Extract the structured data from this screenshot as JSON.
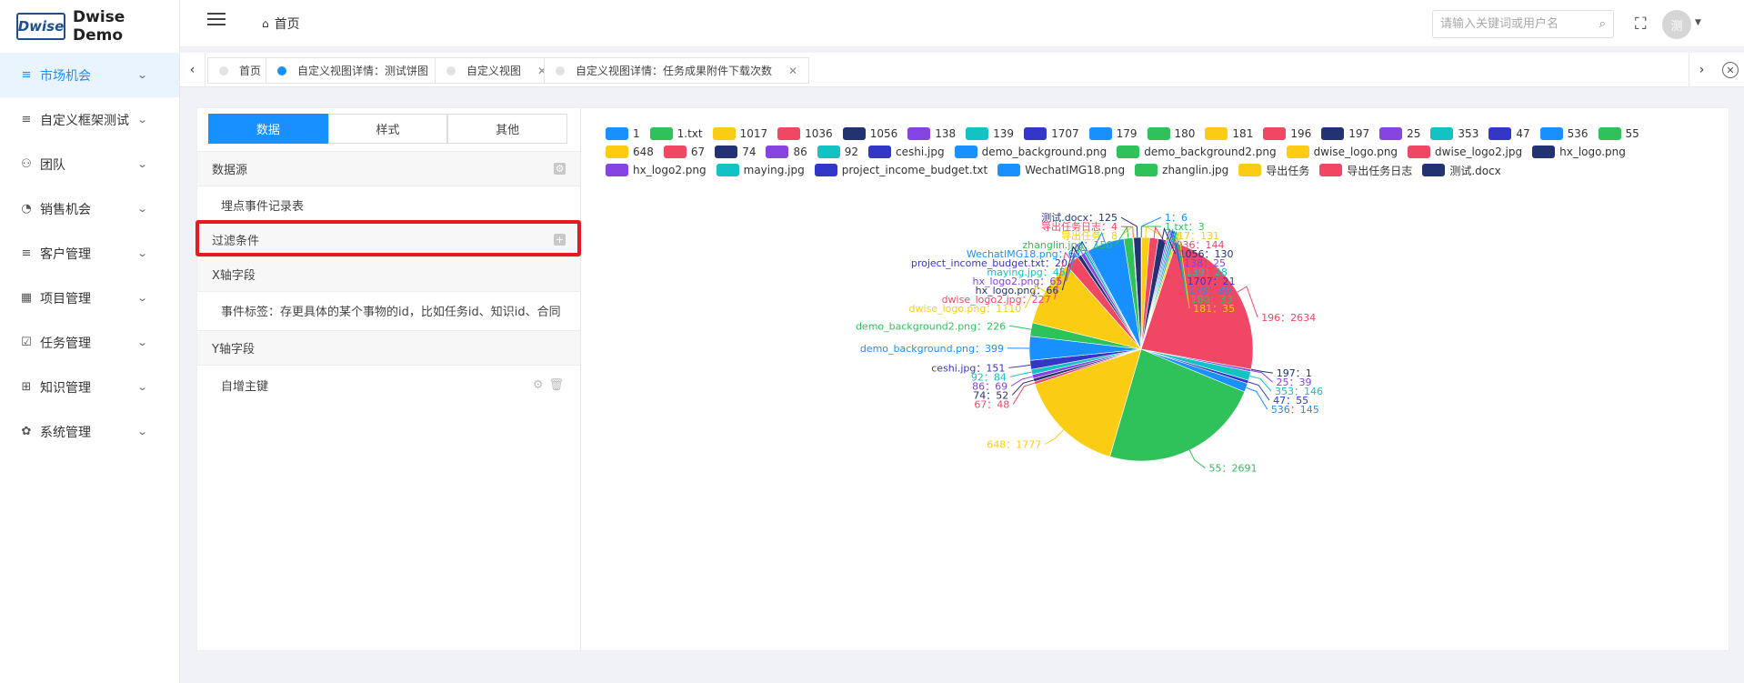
{
  "logo": {
    "mark": "Dwise",
    "text": "Dwise Demo"
  },
  "sidebar": {
    "items": [
      {
        "label": "市场机会",
        "icon": "list-icon",
        "glyph": "≡",
        "active": true
      },
      {
        "label": "自定义框架测试",
        "icon": "list-icon",
        "glyph": "≡",
        "active": false
      },
      {
        "label": "团队",
        "icon": "team-icon",
        "glyph": "⚇",
        "active": false
      },
      {
        "label": "销售机会",
        "icon": "pie-icon",
        "glyph": "◔",
        "active": false
      },
      {
        "label": "客户管理",
        "icon": "list-icon",
        "glyph": "≡",
        "active": false
      },
      {
        "label": "项目管理",
        "icon": "grid-icon",
        "glyph": "▦",
        "active": false
      },
      {
        "label": "任务管理",
        "icon": "checkbox-icon",
        "glyph": "☑",
        "active": false
      },
      {
        "label": "知识管理",
        "icon": "book-icon",
        "glyph": "⊞",
        "active": false
      },
      {
        "label": "系统管理",
        "icon": "gear-icon",
        "glyph": "✿",
        "active": false
      }
    ]
  },
  "header": {
    "breadcrumb": "首页",
    "search_placeholder": "请输入关键词或用户名",
    "avatar_text": "测"
  },
  "tabs": [
    {
      "label": "首页",
      "active": false,
      "closable": false
    },
    {
      "label": "自定义视图详情：测试饼图",
      "active": true,
      "closable": true
    },
    {
      "label": "自定义视图",
      "active": false,
      "closable": true
    },
    {
      "label": "自定义视图详情：任务成果附件下载次数",
      "active": false,
      "closable": true
    }
  ],
  "config": {
    "seg": [
      "数据",
      "样式",
      "其他"
    ],
    "datasource_title": "数据源",
    "datasource_value": "埋点事件记录表",
    "filter_title": "过滤条件",
    "x_title": "X轴字段",
    "x_value": "事件标签：存更具体的某个事物的id，比如任务id、知识id、合同",
    "y_title": "Y轴字段",
    "y_value": "自增主键"
  },
  "chart_data": {
    "type": "pie",
    "slices": [
      {
        "name": "1",
        "value": 6,
        "color": "#1890ff"
      },
      {
        "name": "1.txt",
        "value": 3,
        "color": "#2fc25b"
      },
      {
        "name": "1017",
        "value": 131,
        "color": "#facc14"
      },
      {
        "name": "1036",
        "value": 144,
        "color": "#f04864"
      },
      {
        "name": "1056",
        "value": 130,
        "color": "#223273"
      },
      {
        "name": "138",
        "value": 25,
        "color": "#8543e0"
      },
      {
        "name": "139",
        "value": 28,
        "color": "#13c2c2"
      },
      {
        "name": "1707",
        "value": 21,
        "color": "#3436c7"
      },
      {
        "name": "179",
        "value": 30,
        "color": "#1890ff"
      },
      {
        "name": "180",
        "value": 33,
        "color": "#2fc25b"
      },
      {
        "name": "181",
        "value": 35,
        "color": "#facc14"
      },
      {
        "name": "196",
        "value": 2634,
        "color": "#f04864"
      },
      {
        "name": "197",
        "value": 1,
        "color": "#223273"
      },
      {
        "name": "25",
        "value": 39,
        "color": "#8543e0"
      },
      {
        "name": "353",
        "value": 146,
        "color": "#13c2c2"
      },
      {
        "name": "47",
        "value": 55,
        "color": "#3436c7"
      },
      {
        "name": "536",
        "value": 145,
        "color": "#1890ff"
      },
      {
        "name": "55",
        "value": 2691,
        "color": "#2fc25b"
      },
      {
        "name": "648",
        "value": 1777,
        "color": "#facc14"
      },
      {
        "name": "67",
        "value": 48,
        "color": "#f04864"
      },
      {
        "name": "74",
        "value": 52,
        "color": "#223273"
      },
      {
        "name": "86",
        "value": 69,
        "color": "#8543e0"
      },
      {
        "name": "92",
        "value": 84,
        "color": "#13c2c2"
      },
      {
        "name": "ceshi.jpg",
        "value": 151,
        "color": "#3436c7"
      },
      {
        "name": "demo_background.png",
        "value": 399,
        "color": "#1890ff"
      },
      {
        "name": "demo_background2.png",
        "value": 226,
        "color": "#2fc25b"
      },
      {
        "name": "dwise_logo.png",
        "value": 1110,
        "color": "#facc14"
      },
      {
        "name": "dwise_logo2.jpg",
        "value": 227,
        "color": "#f04864"
      },
      {
        "name": "hx_logo.png",
        "value": 66,
        "color": "#223273"
      },
      {
        "name": "hx_logo2.png",
        "value": 65,
        "color": "#8543e0"
      },
      {
        "name": "maying.jpg",
        "value": 45,
        "color": "#13c2c2"
      },
      {
        "name": "project_income_budget.txt",
        "value": 20,
        "color": "#3436c7"
      },
      {
        "name": "WechatIMG18.png",
        "value": 627,
        "color": "#1890ff"
      },
      {
        "name": "zhanglin.jpg",
        "value": 150,
        "color": "#2fc25b"
      },
      {
        "name": "导出任务",
        "value": 8,
        "color": "#facc14"
      },
      {
        "name": "导出任务日志",
        "value": 4,
        "color": "#f04864"
      },
      {
        "name": "测试.docx",
        "value": 125,
        "color": "#223273"
      }
    ]
  }
}
